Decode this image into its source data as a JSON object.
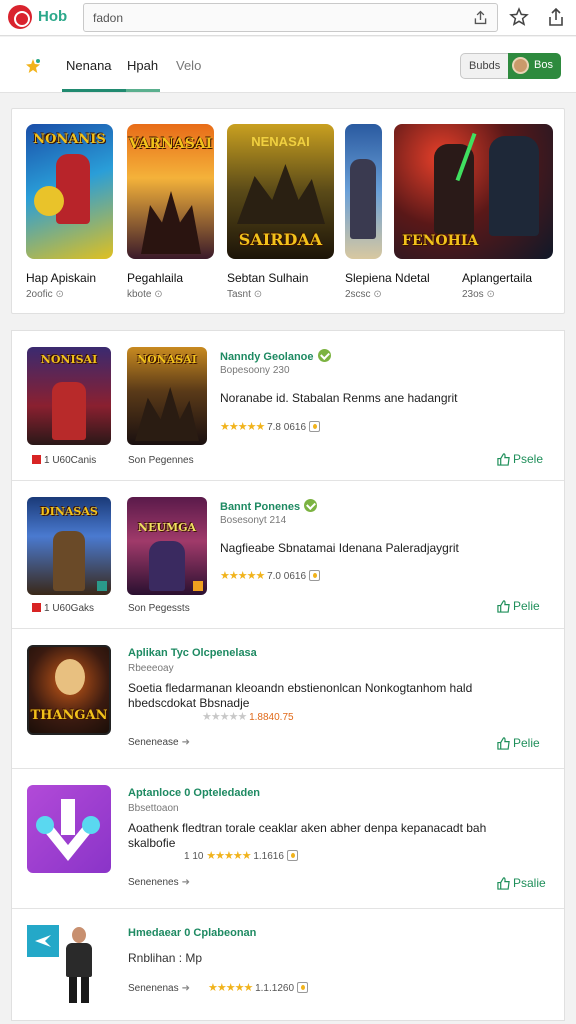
{
  "topbar": {
    "brand": "Hob",
    "url": "fadon"
  },
  "nav": {
    "tabs": [
      "Nenana",
      "Hpah",
      "Velo"
    ],
    "active_tab": 0,
    "toggle_off": "Bubds",
    "toggle_on": "Bos"
  },
  "featured": [
    {
      "name": "Hap Apiskain",
      "sub": "2oofic",
      "art_title": "NONANIS"
    },
    {
      "name": "Pegahlaila",
      "sub": "kbote",
      "art_title": "VARNASAI"
    },
    {
      "name": "Sebtan Sulhain",
      "sub": "Tasnt",
      "art_title": "SAIRDAA"
    },
    {
      "name": "Slepiena Ndetal",
      "sub": "2scsc",
      "art_title": ""
    },
    {
      "name": "Aplangertaila",
      "sub": "23os",
      "art_title": "FENOHIA"
    }
  ],
  "list": [
    {
      "title": "Nanndy Geolanoe",
      "dev": "Bopesoony 230",
      "desc": "Noranabe id. Stabalan Renms ane hadangrit",
      "rating": "7.8 0616",
      "meta1": "1 U60Canis",
      "meta2": "Son Pegennes",
      "install": "Psele",
      "art1": "NONISAI",
      "art2": "NONASAI"
    },
    {
      "title": "Bannt Ponenes",
      "dev": "Bosesonyt 214",
      "desc": "Nagfieabe Sbnatamai Idenana Paleradjaygrit",
      "rating": "7.0 0616",
      "meta1": "1 U60Gaks",
      "meta2": "Son Pegessts",
      "install": "Pelie",
      "art1": "DINASAS",
      "art2": "NEUMGA"
    },
    {
      "title": "Aplikan Tyc Olcpenelasa",
      "dev": "Rbeeeoay",
      "desc": "Soetia fledarmanan kleoandn ebstienonlcan Nonkogtanhom hald hbedscdokat Bbsnadje",
      "rating": "1.8840.75",
      "meta1": "Senenease",
      "install": "Pelie",
      "art1": "THANGAN"
    },
    {
      "title": "Aptanloce 0 Opteledaden",
      "dev": "Bbsettoaon",
      "desc": "Aoathenk fledtran torale ceaklar aken abher denpa kepanacadt bah skalbofie",
      "rating": "1.1616",
      "rating_prefix": "1 10",
      "meta1": "Senenenes",
      "install": "Psalie"
    },
    {
      "title": "Hmedaear 0 Cplabeonan",
      "dev": "Rnblihan : Mp",
      "rating": "1.1.1260",
      "meta1": "Senenenas"
    }
  ],
  "colors": {
    "accent": "#1e8a62",
    "brand_red": "#d9232e",
    "star": "#f1b31c",
    "toggle_on": "#2e8a3e"
  }
}
